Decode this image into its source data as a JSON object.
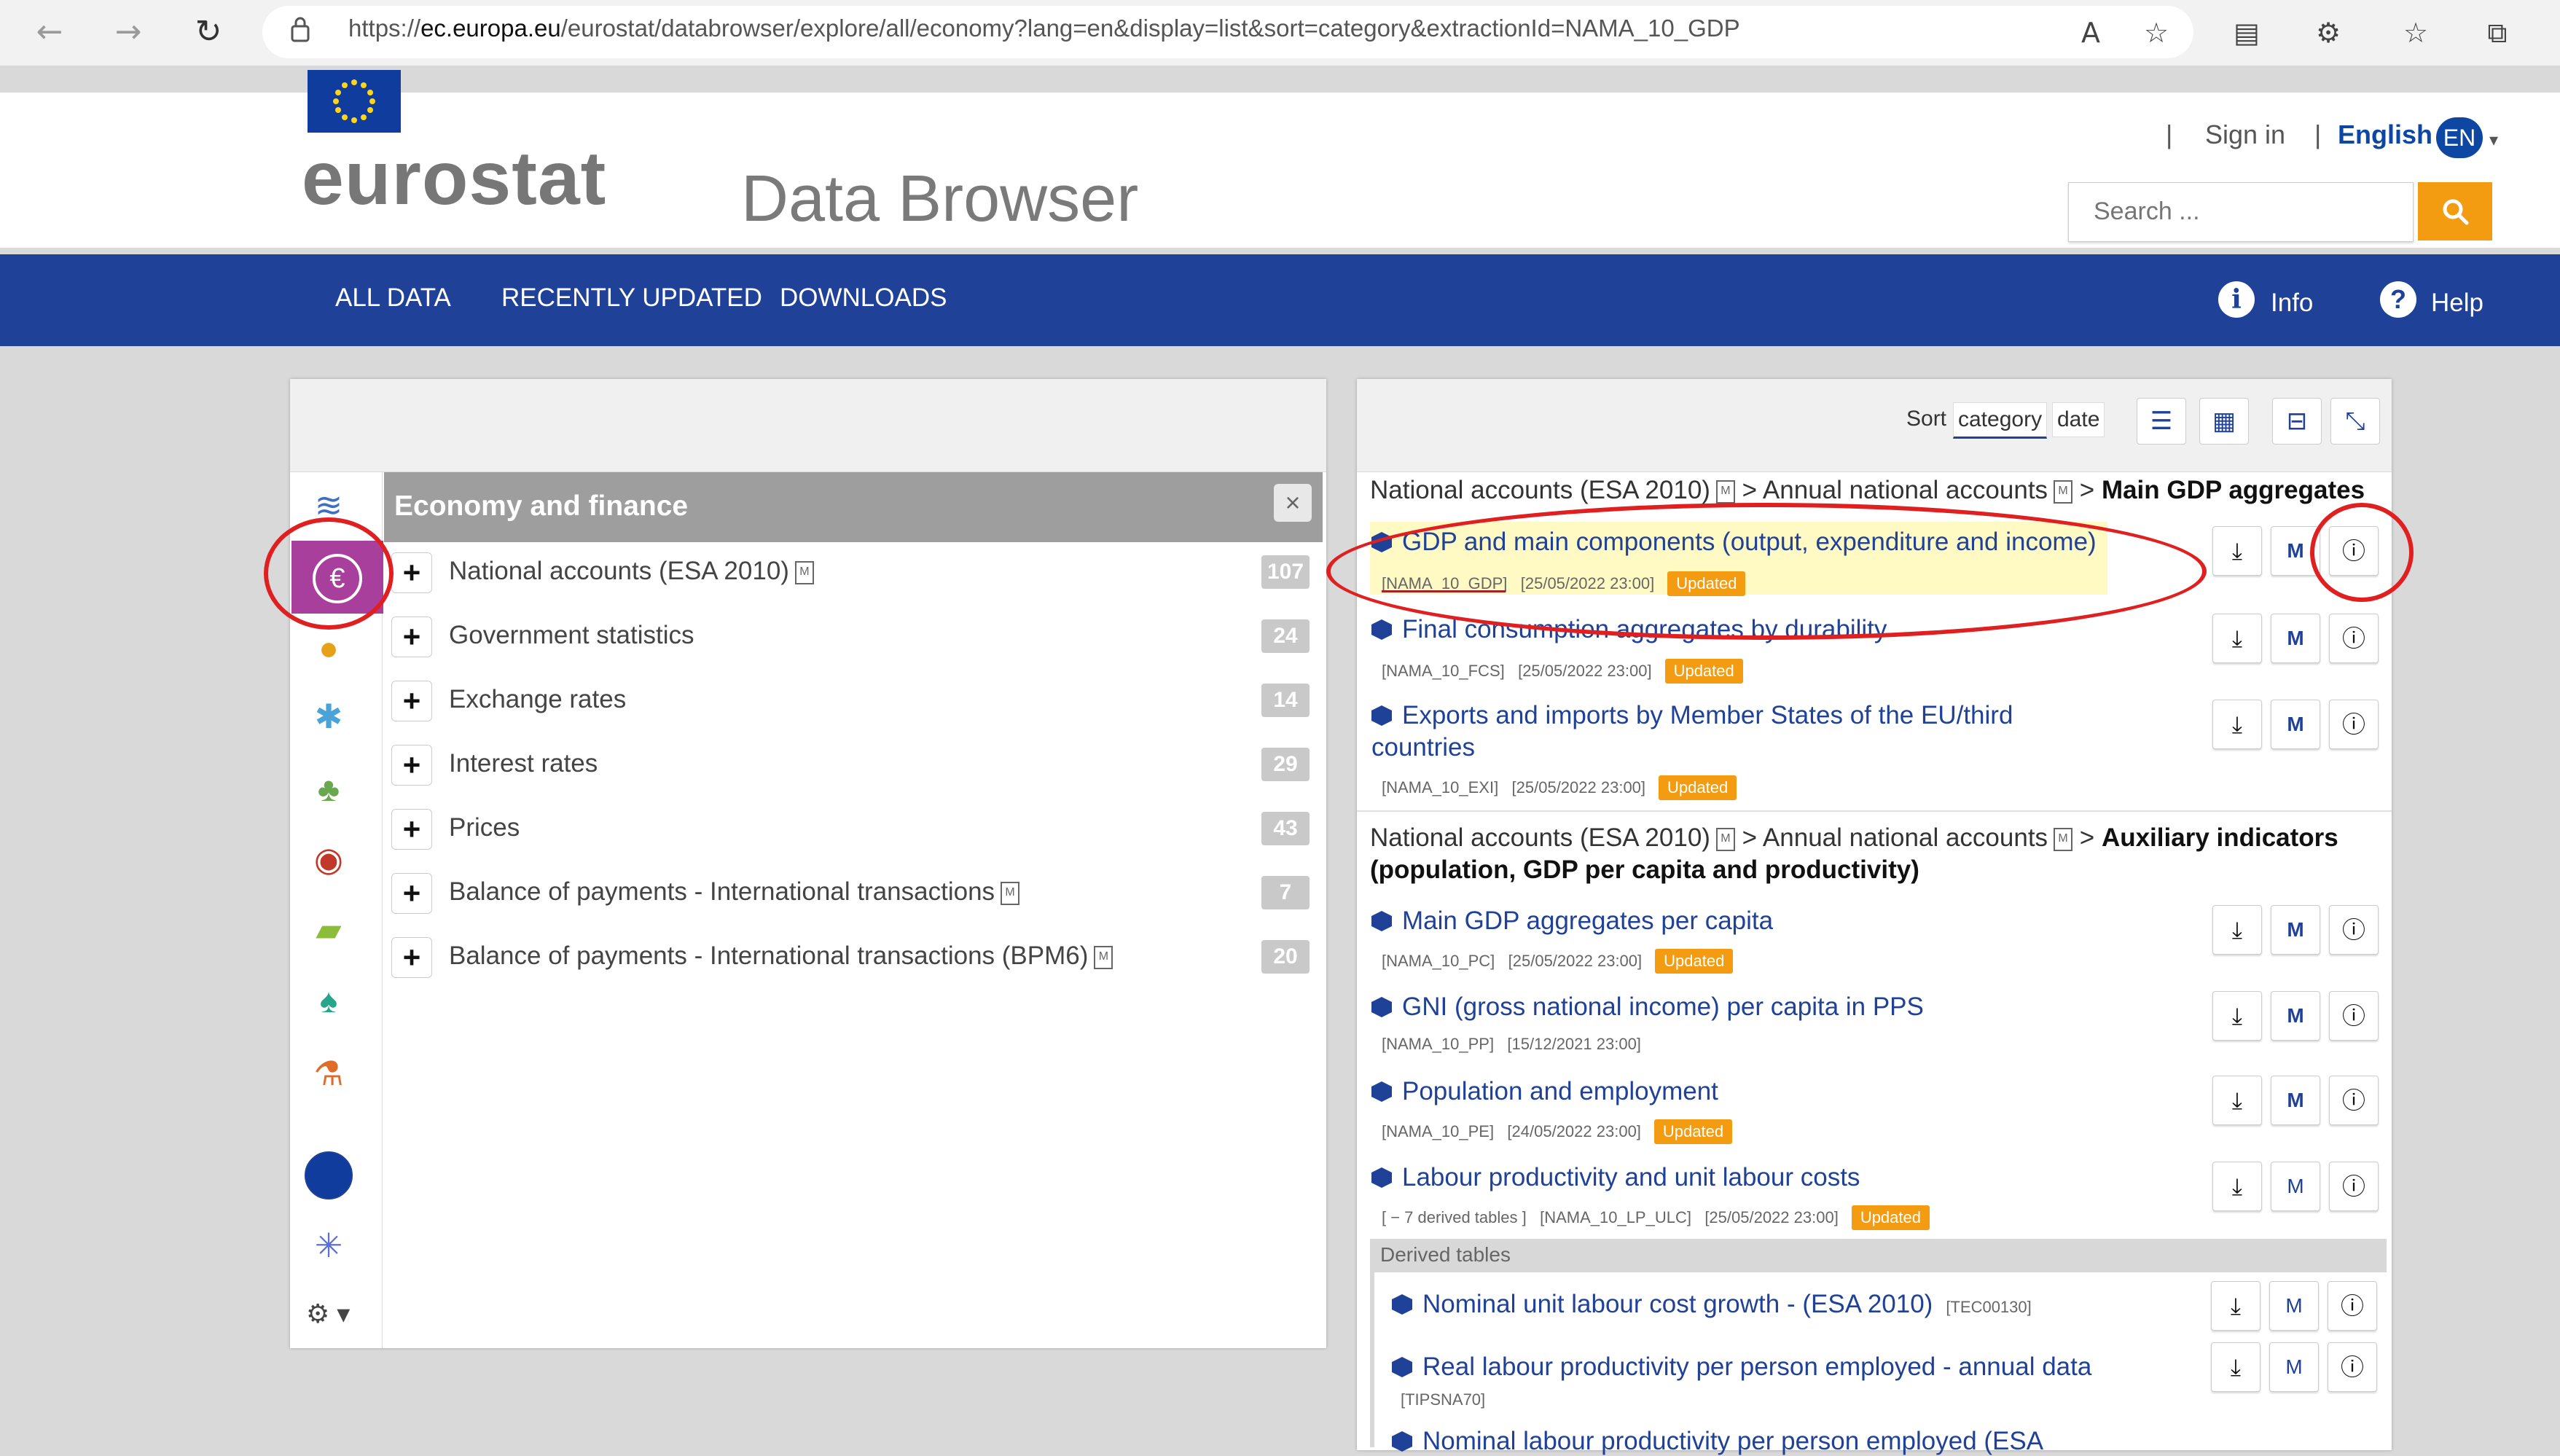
{
  "browser": {
    "url_prefix": "https://",
    "url_domain": "ec.europa.eu",
    "url_path": "/eurostat/databrowser/explore/all/economy?lang=en&display=list&sort=category&extractionId=NAMA_10_GDP",
    "back_icon": "arrow-left",
    "forward_icon": "arrow-right",
    "reload_icon": "reload"
  },
  "header": {
    "logo": "eurostat",
    "app_title": "Data Browser",
    "sign_in": "Sign in",
    "separator": "|",
    "language": "English",
    "language_code": "EN",
    "search_placeholder": "Search ..."
  },
  "nav": {
    "items": [
      "ALL DATA",
      "RECENTLY UPDATED",
      "DOWNLOADS"
    ],
    "info": "Info",
    "help": "Help"
  },
  "left_panel": {
    "category_title": "Economy and finance",
    "categories": [
      {
        "label": "National accounts (ESA 2010)",
        "count": "107",
        "meta": true
      },
      {
        "label": "Government statistics",
        "count": "24",
        "meta": false
      },
      {
        "label": "Exchange rates",
        "count": "14",
        "meta": false
      },
      {
        "label": "Interest rates",
        "count": "29",
        "meta": false
      },
      {
        "label": "Prices",
        "count": "43",
        "meta": false
      },
      {
        "label": "Balance of payments - International transactions",
        "count": "7",
        "meta": true
      },
      {
        "label": "Balance of payments - International transactions (BPM6)",
        "count": "20",
        "meta": true
      }
    ]
  },
  "right_panel": {
    "sort_label": "Sort",
    "sort_options": [
      "category",
      "date"
    ],
    "groups": [
      {
        "breadcrumb": [
          "National accounts (ESA 2010)",
          "Annual national accounts"
        ],
        "current": "Main GDP aggregates",
        "datasets": [
          {
            "title": "GDP and main components (output, expenditure and income)",
            "code": "[NAMA_10_GDP]",
            "date": "[25/05/2022 23:00]",
            "badge": "Updated"
          },
          {
            "title": "Final consumption aggregates by durability",
            "code": "[NAMA_10_FCS]",
            "date": "[25/05/2022 23:00]",
            "badge": "Updated"
          },
          {
            "title": "Exports and imports by Member States of the EU/third",
            "title2": "countries",
            "code": "[NAMA_10_EXI]",
            "date": "[25/05/2022 23:00]",
            "badge": "Updated"
          }
        ]
      },
      {
        "breadcrumb": [
          "National accounts (ESA 2010)",
          "Annual national accounts"
        ],
        "current": "Auxiliary indicators",
        "current2": "(population, GDP per capita and productivity)",
        "datasets": [
          {
            "title": "Main GDP aggregates per capita",
            "code": "[NAMA_10_PC]",
            "date": "[25/05/2022 23:00]",
            "badge": "Updated"
          },
          {
            "title": "GNI (gross national income) per capita in PPS",
            "code": "[NAMA_10_PP]",
            "date": "[15/12/2021 23:00]",
            "badge": ""
          },
          {
            "title": "Population and employment",
            "code": "[NAMA_10_PE]",
            "date": "[24/05/2022 23:00]",
            "badge": "Updated"
          },
          {
            "title": "Labour productivity and unit labour costs",
            "derived": "[ − 7 derived tables ]",
            "code": "[NAMA_10_LP_ULC]",
            "date": "[25/05/2022 23:00]",
            "badge": "Updated"
          }
        ]
      }
    ],
    "derived_label": "Derived tables",
    "derived": [
      {
        "title": "Nominal unit labour cost growth - (ESA 2010)",
        "code": "[TEC00130]"
      },
      {
        "title": "Real labour productivity per person employed - annual data",
        "code": "[TIPSNA70]"
      },
      {
        "title": "Nominal labour productivity per person employed (ESA",
        "code": ""
      }
    ]
  },
  "icons": {
    "download": "download-icon",
    "metadata": "metadata-icon",
    "info": "info-icon"
  },
  "colors": {
    "nav_blue": "#1f4197",
    "accent_orange": "#f39c12",
    "economy_theme": "#a83f9d",
    "annotation_red": "#e02020"
  }
}
